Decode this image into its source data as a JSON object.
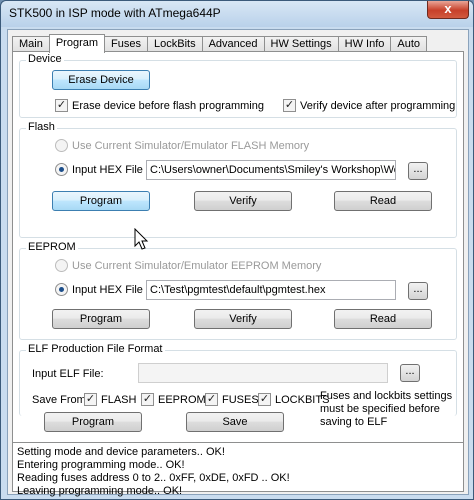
{
  "window": {
    "title": "STK500 in ISP mode with ATmega644P",
    "close_glyph": "x"
  },
  "tabs": [
    {
      "label": "Main",
      "active": false
    },
    {
      "label": "Program",
      "active": true
    },
    {
      "label": "Fuses",
      "active": false
    },
    {
      "label": "LockBits",
      "active": false
    },
    {
      "label": "Advanced",
      "active": false
    },
    {
      "label": "HW Settings",
      "active": false
    },
    {
      "label": "HW Info",
      "active": false
    },
    {
      "label": "Auto",
      "active": false
    }
  ],
  "device": {
    "group_label": "Device",
    "erase_button": "Erase Device",
    "erase_before_flash": {
      "label": "Erase device before flash programming",
      "checked": true
    },
    "verify_after": {
      "label": "Verify device after programming",
      "checked": true
    }
  },
  "flash": {
    "group_label": "Flash",
    "use_simulator_label": "Use Current Simulator/Emulator FLASH Memory",
    "input_hex_label": "Input HEX File",
    "hex_path": "C:\\Users\\owner\\Documents\\Smiley's Workshop\\Worksho",
    "browse_label": "...",
    "program_button": "Program",
    "verify_button": "Verify",
    "read_button": "Read"
  },
  "eeprom": {
    "group_label": "EEPROM",
    "use_simulator_label": "Use Current Simulator/Emulator EEPROM Memory",
    "input_hex_label": "Input HEX File",
    "hex_path": "C:\\Test\\pgmtest\\default\\pgmtest.hex",
    "browse_label": "...",
    "program_button": "Program",
    "verify_button": "Verify",
    "read_button": "Read"
  },
  "elf": {
    "group_label": "ELF Production File Format",
    "input_elf_label": "Input ELF File:",
    "elf_path": "",
    "browse_label": "...",
    "save_from_label": "Save From:",
    "options": [
      {
        "label": "FLASH",
        "checked": true
      },
      {
        "label": "EEPROM",
        "checked": true
      },
      {
        "label": "FUSES",
        "checked": true
      },
      {
        "label": "LOCKBITS",
        "checked": true
      }
    ],
    "note_lines": [
      "Fuses and lockbits settings",
      "must be specified before",
      "saving to ELF"
    ],
    "program_button": "Program",
    "save_button": "Save"
  },
  "log": [
    "Setting mode and device parameters.. OK!",
    "Entering programming mode.. OK!",
    "Reading fuses address 0 to 2.. 0xFF, 0xDE, 0xFD .. OK!",
    "Leaving programming mode.. OK!"
  ],
  "check_glyph": "✓"
}
